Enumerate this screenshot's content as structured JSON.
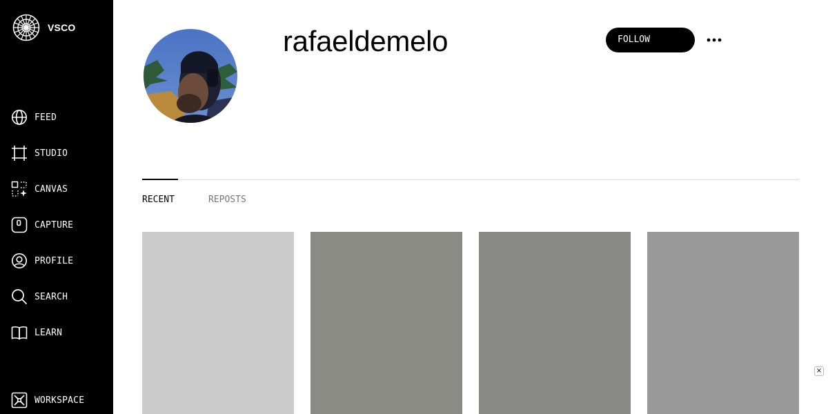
{
  "sidebar": {
    "logo_text": "VSCO",
    "items": [
      {
        "label": "FEED",
        "icon": "globe-icon"
      },
      {
        "label": "STUDIO",
        "icon": "crop-frame-icon"
      },
      {
        "label": "CANVAS",
        "icon": "canvas-sparkle-icon"
      },
      {
        "label": "CAPTURE",
        "icon": "camera-app-icon"
      },
      {
        "label": "PROFILE",
        "icon": "profile-icon"
      },
      {
        "label": "SEARCH",
        "icon": "search-icon"
      },
      {
        "label": "LEARN",
        "icon": "book-icon"
      }
    ],
    "workspace": {
      "label": "WORKSPACE",
      "icon": "workspace-icon"
    }
  },
  "profile": {
    "username": "rafaeldemelo",
    "follow_label": "FOLLOW",
    "more_icon": "more-dots-icon"
  },
  "tabs": {
    "recent": "RECENT",
    "reposts": "REPOSTS",
    "active": "RECENT"
  },
  "grid": {
    "tile_colors": [
      "#cccccc",
      "#8b8b85",
      "#888884",
      "#999999"
    ]
  },
  "close_badge": "×",
  "colors": {
    "sidebar_bg": "#000000",
    "follow_bg": "#000000",
    "inactive_tab": "#767676"
  }
}
